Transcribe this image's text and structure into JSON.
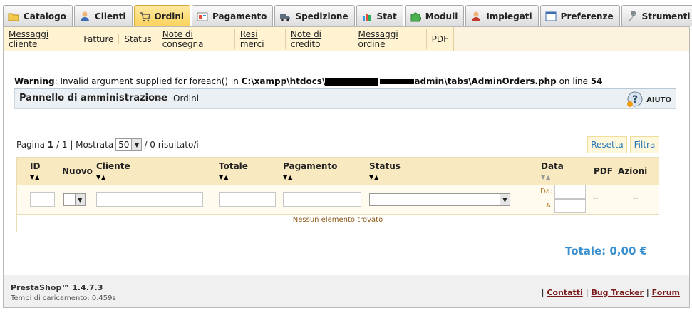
{
  "tabs": [
    {
      "label": "Catalogo",
      "icon": "folder-icon"
    },
    {
      "label": "Clienti",
      "icon": "user-icon"
    },
    {
      "label": "Ordini",
      "icon": "cart-icon",
      "active": true
    },
    {
      "label": "Pagamento",
      "icon": "payment-icon"
    },
    {
      "label": "Spedizione",
      "icon": "truck-icon"
    },
    {
      "label": "Stat",
      "icon": "chart-icon"
    },
    {
      "label": "Moduli",
      "icon": "puzzle-icon"
    },
    {
      "label": "Impiegati",
      "icon": "employee-icon"
    },
    {
      "label": "Preferenze",
      "icon": "preferences-icon"
    },
    {
      "label": "Strumenti",
      "icon": "wrench-icon"
    }
  ],
  "submenu": [
    "Messaggi cliente",
    "Fatture",
    "Status",
    "Note di consegna",
    "Resi merci",
    "Note di credito",
    "Messaggi ordine",
    "PDF"
  ],
  "warning": {
    "label": "Warning",
    "text1": ": Invalid argument supplied for foreach() in ",
    "path_start": "C:\\xampp\\htdocs\\",
    "path_end": "admin\\tabs\\AdminOrders.php",
    "text2": " on line ",
    "line": "54"
  },
  "breadcrumb": {
    "root": "Pannello di amministrazione",
    "separator": ">",
    "current": "Ordini"
  },
  "help": {
    "label": "AIUTO"
  },
  "pagination": {
    "prefix": "Pagina",
    "page": "1",
    "of": "/ 1",
    "shown_label": "| Mostrata",
    "per_page": "50",
    "results": "/ 0 risultato/i"
  },
  "buttons": {
    "reset": "Resetta",
    "filter": "Filtra"
  },
  "table": {
    "columns": [
      "ID",
      "Nuovo",
      "Cliente",
      "Totale",
      "Pagamento",
      "Status",
      "Data",
      "PDF",
      "Azioni"
    ],
    "filter_new_value": "--",
    "filter_status_value": "--",
    "date_from_label": "Da:",
    "date_to_label": "A",
    "pdf_placeholder": "--",
    "actions_placeholder": "--",
    "empty_message": "Nessun elemento trovato"
  },
  "total": "Totale: 0,00 €",
  "footer": {
    "version": "PrestaShop™ 1.4.7.3",
    "load_time": "Tempi di caricamento: 0.459s",
    "links": [
      "Contatti",
      "Bug Tracker",
      "Forum"
    ]
  },
  "colors": {
    "active_tab": "#fcd25a",
    "accent_blue": "#3a8fd0",
    "submenu_bg": "#fff3d2",
    "table_header": "#f9e9c0"
  }
}
